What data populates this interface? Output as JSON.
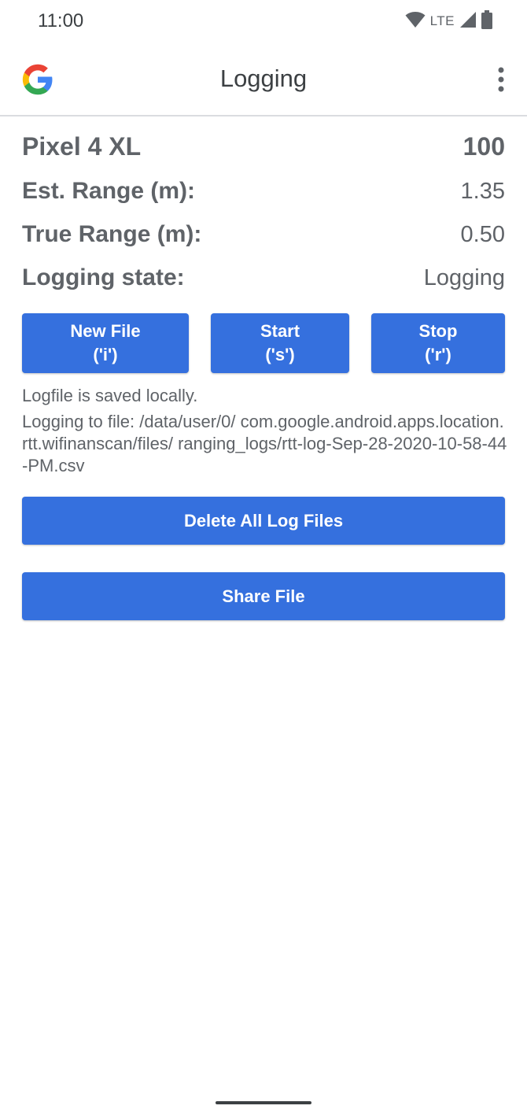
{
  "status_bar": {
    "time": "11:00",
    "network": "LTE",
    "icons": [
      "wifi-icon",
      "cell-signal-icon",
      "battery-icon"
    ]
  },
  "app_bar": {
    "title": "Logging",
    "logo": "google-logo-icon",
    "menu_icon": "more-vert-icon"
  },
  "info": {
    "device_label": "Pixel 4 XL",
    "device_value": "100",
    "est_range_label": "Est. Range (m):",
    "est_range_value": "1.35",
    "true_range_label": "True Range (m):",
    "true_range_value": "0.50",
    "logging_state_label": "Logging state:",
    "logging_state_value": "Logging"
  },
  "buttons": {
    "new_file_line1": "New File",
    "new_file_line2": "('i')",
    "start_line1": "Start",
    "start_line2": "('s')",
    "stop_line1": "Stop",
    "stop_line2": "('r')",
    "delete_all": "Delete All Log Files",
    "share_file": "Share File"
  },
  "log": {
    "saved_text": "Logfile is saved locally.",
    "path_text": "Logging to file: /data/user/0/ com.google.android.apps.location.rtt.wifinanscan/files/ ranging_logs/rtt-log-Sep-28-2020-10-58-44-PM.csv"
  },
  "colors": {
    "accent": "#3570de",
    "text": "#5f6368",
    "background": "#ffffff"
  }
}
